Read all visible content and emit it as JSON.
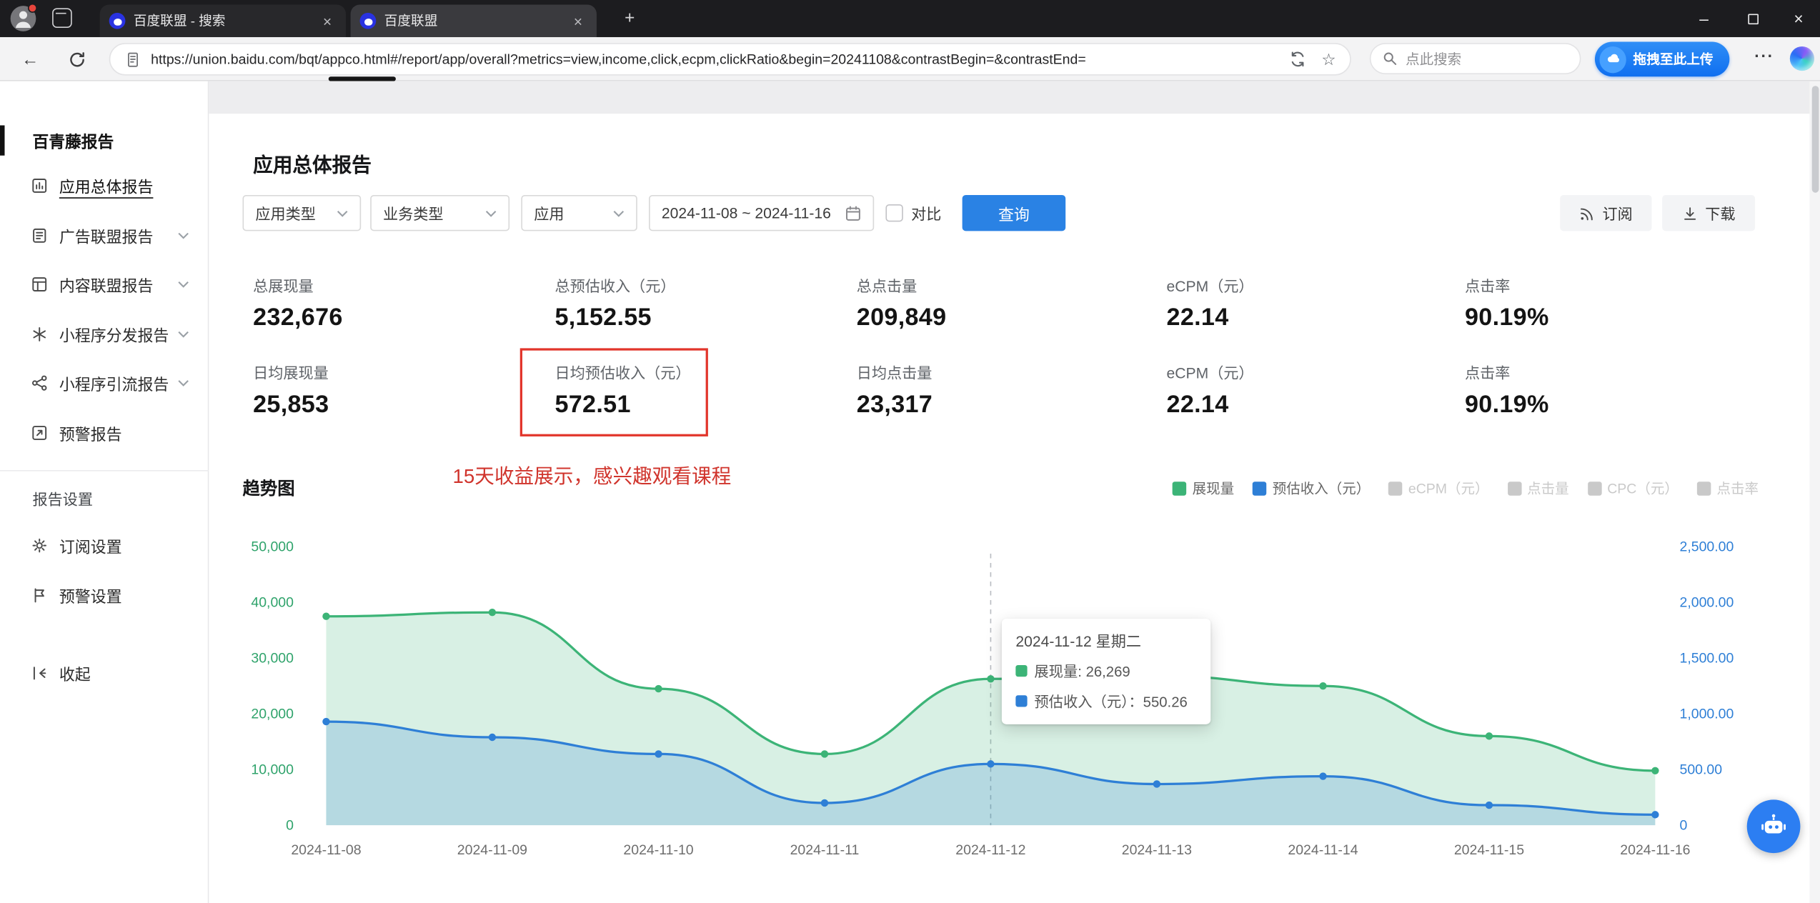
{
  "glyphs": {
    "back": "←",
    "plus": "+",
    "minimize": "–",
    "close": "×",
    "tab_close": "×",
    "menu_dots": "···",
    "star": "☆"
  },
  "browser": {
    "tabs": [
      {
        "title": "百度联盟 - 搜索"
      },
      {
        "title": "百度联盟"
      }
    ],
    "url": "https://union.baidu.com/bqt/appco.html#/report/app/overall?metrics=view,income,click,ecpm,clickRatio&begin=20241108&contrastBegin=&contrastEnd=",
    "search_placeholder": "点此搜索",
    "upload_button_label": "拖拽至此上传"
  },
  "sidebar": {
    "brand": "百青藤报告",
    "items": [
      {
        "label": "应用总体报告",
        "active": true
      },
      {
        "label": "广告联盟报告",
        "expandable": true
      },
      {
        "label": "内容联盟报告",
        "expandable": true
      },
      {
        "label": "小程序分发报告",
        "expandable": true
      },
      {
        "label": "小程序引流报告",
        "expandable": true
      },
      {
        "label": "预警报告"
      }
    ],
    "section_title": "报告设置",
    "settings_items": [
      {
        "label": "订阅设置"
      },
      {
        "label": "预警设置"
      }
    ],
    "collapse_label": "收起"
  },
  "page": {
    "title": "应用总体报告",
    "annotation": "15天收益展示，感兴趣观看课程",
    "trend_title": "趋势图"
  },
  "filters": {
    "app_type": "应用类型",
    "business_type": "业务类型",
    "app": "应用",
    "date_range": "2024-11-08 ~ 2024-11-16",
    "compare_label": "对比",
    "query_button": "查询",
    "subscribe_button": "订阅",
    "download_button": "下载"
  },
  "stats": {
    "rows": [
      {
        "cells": [
          {
            "label": "总展现量",
            "value": "232,676"
          },
          {
            "label": "总预估收入（元）",
            "value": "5,152.55"
          },
          {
            "label": "总点击量",
            "value": "209,849"
          },
          {
            "label": "eCPM（元）",
            "value": "22.14"
          },
          {
            "label": "点击率",
            "value": "90.19%"
          }
        ]
      },
      {
        "cells": [
          {
            "label": "日均展现量",
            "value": "25,853"
          },
          {
            "label": "日均预估收入（元）",
            "value": "572.51",
            "highlighted": true
          },
          {
            "label": "日均点击量",
            "value": "23,317"
          },
          {
            "label": "eCPM（元）",
            "value": "22.14"
          },
          {
            "label": "点击率",
            "value": "90.19%"
          }
        ]
      }
    ]
  },
  "chart_data": {
    "type": "area",
    "title": "趋势图",
    "categories": [
      "2024-11-08",
      "2024-11-09",
      "2024-11-10",
      "2024-11-11",
      "2024-11-12",
      "2024-11-13",
      "2024-11-14",
      "2024-11-15",
      "2024-11-16"
    ],
    "series": [
      {
        "name": "展现量",
        "axis": "left",
        "color": "#3CB477",
        "values": [
          37500,
          38200,
          24500,
          12800,
          26269,
          26800,
          25000,
          16000,
          9800
        ]
      },
      {
        "name": "预估收入（元）",
        "axis": "right",
        "color": "#2E7FD6",
        "values": [
          930,
          790,
          640,
          200,
          550.26,
          370,
          440,
          180,
          95
        ]
      }
    ],
    "left_axis": {
      "min": 0,
      "max": 50000,
      "labels": [
        "0",
        "10,000",
        "20,000",
        "30,000",
        "40,000",
        "50,000"
      ],
      "color": "#2FA36B"
    },
    "right_axis": {
      "min": 0,
      "max": 2500,
      "labels": [
        "0",
        "500.00",
        "1,000.00",
        "1,500.00",
        "2,000.00",
        "2,500.00"
      ],
      "color": "#2E7FD6"
    },
    "x_label_color": "#6e6e6e",
    "grid": false,
    "legend_position": "top-right",
    "legend": [
      {
        "label": "展现量",
        "color": "#3CB477",
        "active": true
      },
      {
        "label": "预估收入（元）",
        "color": "#2E7FD6",
        "active": true
      },
      {
        "label": "eCPM（元）",
        "color": "#C9C9C9",
        "active": false
      },
      {
        "label": "点击量",
        "color": "#C9C9C9",
        "active": false
      },
      {
        "label": "CPC（元）",
        "color": "#C9C9C9",
        "active": false
      },
      {
        "label": "点击率",
        "color": "#C9C9C9",
        "active": false
      }
    ],
    "tooltip": {
      "title": "2024-11-12 星期二",
      "anchor_index": 4,
      "items": [
        {
          "label": "展现量",
          "separator": ": ",
          "value": "26,269",
          "color": "#3CB477"
        },
        {
          "label": "预估收入（元）",
          "separator": "：",
          "value": "550.26",
          "color": "#2E7FD6"
        }
      ]
    }
  }
}
